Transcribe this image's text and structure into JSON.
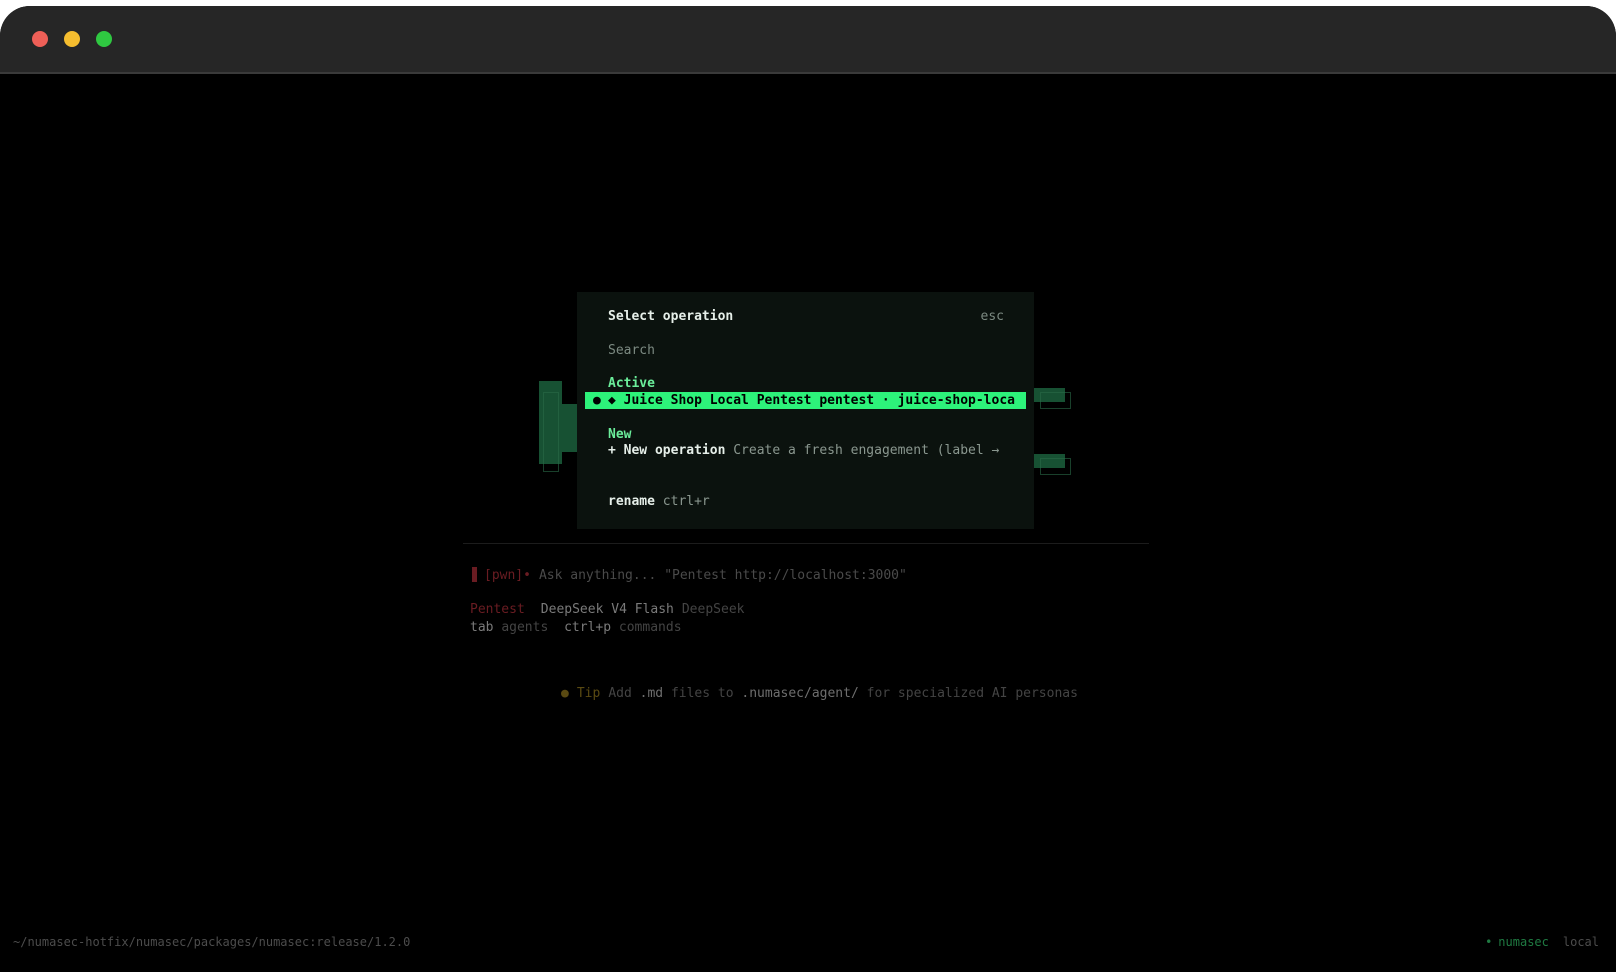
{
  "dialog": {
    "title": "Select operation",
    "esc_label": "esc",
    "search_placeholder": "Search",
    "active_heading": "Active",
    "selected_bullet": "●",
    "selected_label": "◆ Juice Shop Local Pentest pentest · juice-shop-loca",
    "new_heading": "New",
    "new_op_plus": "+",
    "new_op_name": "New operation",
    "new_op_desc": "Create a fresh engagement (label → k",
    "rename_key": "rename",
    "rename_hint": "ctrl+r"
  },
  "prompt": {
    "tag": "[pwn]",
    "dot": "•",
    "placeholder": "Ask anything... \"Pentest http://localhost:3000\""
  },
  "status": {
    "agent": "Pentest",
    "model": "DeepSeek V4 Flash",
    "provider": "DeepSeek",
    "key1": "tab",
    "key1_label": "agents",
    "key2": "ctrl+p",
    "key2_label": "commands"
  },
  "tip": {
    "dot": "●",
    "label": "Tip",
    "text_a": "Add",
    "text_b": ".md",
    "text_c": "files to",
    "text_d": ".numasec/agent/",
    "text_e": "for specialized AI personas"
  },
  "footer": {
    "path": "~/numasec-hotfix/numasec/packages/numasec:release/1.2.0",
    "dot": "•",
    "brand": "numasec",
    "mode": "local"
  },
  "colors": {
    "accent": "#2df27a",
    "heading": "#6bee9b",
    "danger": "#6a1c22"
  }
}
